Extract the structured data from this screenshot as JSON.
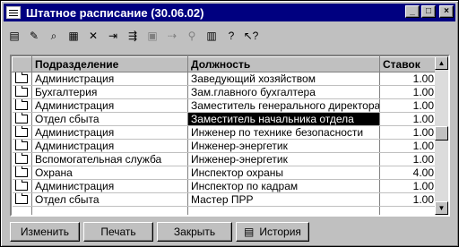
{
  "window": {
    "title": "Штатное расписание (30.06.02)"
  },
  "titlebar_buttons": {
    "minimize": "_",
    "maximize": "□",
    "close": "×"
  },
  "toolbar": [
    {
      "icon": "new-row-icon",
      "glyph": "▤",
      "disabled": false
    },
    {
      "icon": "edit-row-icon",
      "glyph": "✎",
      "disabled": false
    },
    {
      "icon": "find-icon",
      "glyph": "⌕",
      "disabled": false
    },
    {
      "icon": "new-group-icon",
      "glyph": "▦",
      "disabled": false
    },
    {
      "icon": "delete-row-icon",
      "glyph": "✕",
      "disabled": false
    },
    {
      "icon": "move-down-icon",
      "glyph": "⇥",
      "disabled": false
    },
    {
      "icon": "move-to-group-icon",
      "glyph": "⇶",
      "disabled": false
    },
    {
      "icon": "copy-icon",
      "glyph": "▣",
      "disabled": true
    },
    {
      "icon": "transfer-icon",
      "glyph": "⇢",
      "disabled": true
    },
    {
      "icon": "filter-icon",
      "glyph": "⚲",
      "disabled": true
    },
    {
      "icon": "print-icon",
      "glyph": "▥",
      "disabled": false
    },
    {
      "icon": "help-icon",
      "glyph": "?",
      "disabled": false
    },
    {
      "icon": "context-help-icon",
      "glyph": "↖?",
      "disabled": false
    }
  ],
  "grid": {
    "columns": [
      "",
      "Подразделение",
      "Должность",
      "Ставок"
    ],
    "rows": [
      {
        "dept": "Администрация",
        "position": "Заведующий хозяйством",
        "rate": "1.00"
      },
      {
        "dept": "Бухгалтерия",
        "position": "Зам.главного бухгалтера",
        "rate": "1.00"
      },
      {
        "dept": "Администрация",
        "position": "Заместитель генерального директора",
        "rate": "1.00"
      },
      {
        "dept": "Отдел сбыта",
        "position": "Заместитель начальника отдела",
        "rate": "1.00"
      },
      {
        "dept": "Администрация",
        "position": "Инженер по технике безопасности",
        "rate": "1.00"
      },
      {
        "dept": "Администрация",
        "position": "Инженер-энергетик",
        "rate": "1.00"
      },
      {
        "dept": "Вспомогательная служба",
        "position": "Инженер-энергетик",
        "rate": "1.00"
      },
      {
        "dept": "Охрана",
        "position": "Инспектор охраны",
        "rate": "4.00"
      },
      {
        "dept": "Администрация",
        "position": "Инспектор по кадрам",
        "rate": "1.00"
      },
      {
        "dept": "Отдел сбыта",
        "position": "Мастер ПРР",
        "rate": "1.00"
      },
      {
        "dept": "",
        "position": "",
        "rate": ""
      }
    ],
    "selected_row": 3
  },
  "buttons": {
    "edit": "Изменить",
    "print": "Печать",
    "close": "Закрыть",
    "history": "История"
  }
}
